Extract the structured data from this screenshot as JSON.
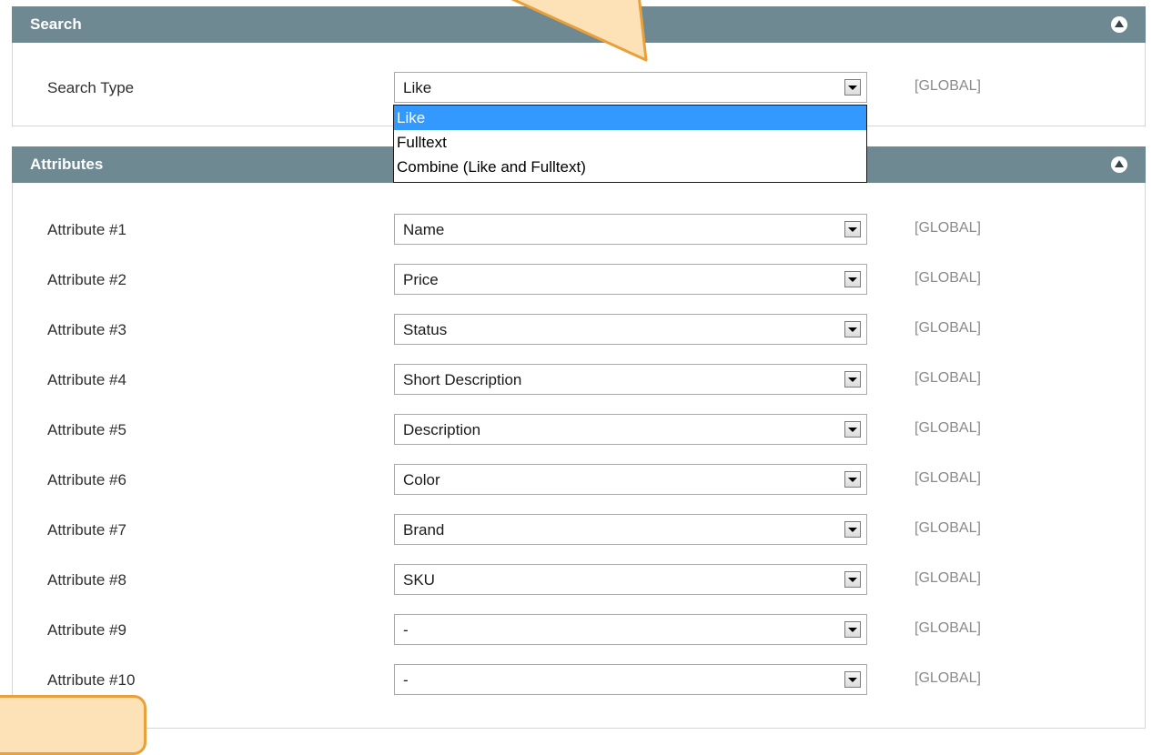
{
  "search_section": {
    "title": "Search",
    "search_type": {
      "label": "Search Type",
      "value": "Like",
      "scope": "[GLOBAL]",
      "options": [
        "Like",
        "Fulltext",
        "Combine (Like and Fulltext)"
      ],
      "highlighted_option": "Like"
    }
  },
  "attributes_section": {
    "title": "Attributes",
    "rows": [
      {
        "label": "Attribute #1",
        "value": "Name",
        "scope": "[GLOBAL]"
      },
      {
        "label": "Attribute #2",
        "value": "Price",
        "scope": "[GLOBAL]"
      },
      {
        "label": "Attribute #3",
        "value": "Status",
        "scope": "[GLOBAL]"
      },
      {
        "label": "Attribute #4",
        "value": "Short Description",
        "scope": "[GLOBAL]"
      },
      {
        "label": "Attribute #5",
        "value": "Description",
        "scope": "[GLOBAL]"
      },
      {
        "label": "Attribute #6",
        "value": "Color",
        "scope": "[GLOBAL]"
      },
      {
        "label": "Attribute #7",
        "value": "Brand",
        "scope": "[GLOBAL]"
      },
      {
        "label": "Attribute #8",
        "value": "SKU",
        "scope": "[GLOBAL]"
      },
      {
        "label": "Attribute #9",
        "value": "-",
        "scope": "[GLOBAL]"
      },
      {
        "label": "Attribute #10",
        "value": "-",
        "scope": "[GLOBAL]"
      }
    ]
  },
  "colors": {
    "header_bg": "#6f8992",
    "highlight": "#3399ff",
    "callout_fill": "#fde2b8",
    "callout_border": "#e8a03a"
  },
  "icons": {
    "collapse": "collapse-up-icon",
    "select_arrow": "dropdown-arrow-icon"
  }
}
